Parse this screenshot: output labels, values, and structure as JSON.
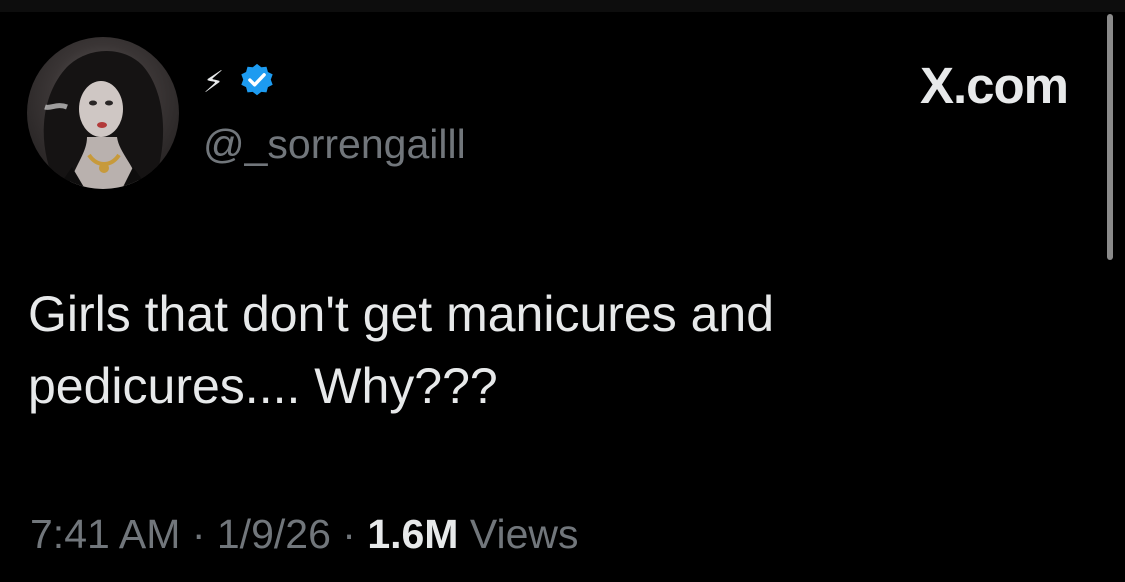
{
  "author": {
    "display_name_icon": "lightning-bolt-emoji",
    "verified": true,
    "handle": "@_sorrengailll"
  },
  "brand": {
    "label": "X.com"
  },
  "tweet": {
    "text_line1": "Girls that don't get manicures and",
    "text_line2": "pedicures.... Why???"
  },
  "meta": {
    "time": "7:41 AM",
    "separator1": " · ",
    "date": "1/9/26",
    "separator2": " · ",
    "views_count": "1.6M",
    "views_label": " Views"
  },
  "colors": {
    "background": "#000000",
    "primary_text": "#e7e9ea",
    "secondary_text": "#71767b",
    "verified_badge": "#1d9bf0"
  }
}
